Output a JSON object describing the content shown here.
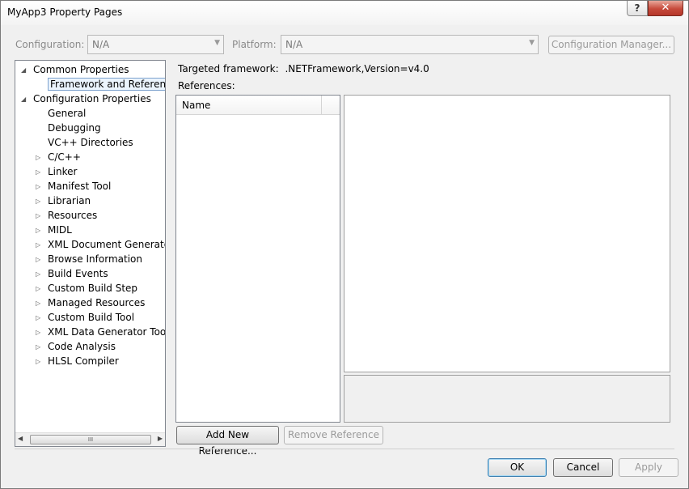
{
  "window": {
    "title": "MyApp3 Property Pages",
    "help_glyph": "?",
    "close_glyph": "✕"
  },
  "toolbar": {
    "configuration_label": "Configuration:",
    "configuration_value": "N/A",
    "platform_label": "Platform:",
    "platform_value": "N/A",
    "config_manager_label": "Configuration Manager..."
  },
  "tree": {
    "items": [
      {
        "label": "Common Properties",
        "expander": "◢"
      },
      {
        "label": "Framework and References",
        "expander": ""
      },
      {
        "label": "Configuration Properties",
        "expander": "◢"
      },
      {
        "label": "General",
        "expander": ""
      },
      {
        "label": "Debugging",
        "expander": ""
      },
      {
        "label": "VC++ Directories",
        "expander": ""
      },
      {
        "label": "C/C++",
        "expander": "▷"
      },
      {
        "label": "Linker",
        "expander": "▷"
      },
      {
        "label": "Manifest Tool",
        "expander": "▷"
      },
      {
        "label": "Librarian",
        "expander": "▷"
      },
      {
        "label": "Resources",
        "expander": "▷"
      },
      {
        "label": "MIDL",
        "expander": "▷"
      },
      {
        "label": "XML Document Generator",
        "expander": "▷"
      },
      {
        "label": "Browse Information",
        "expander": "▷"
      },
      {
        "label": "Build Events",
        "expander": "▷"
      },
      {
        "label": "Custom Build Step",
        "expander": "▷"
      },
      {
        "label": "Managed Resources",
        "expander": "▷"
      },
      {
        "label": "Custom Build Tool",
        "expander": "▷"
      },
      {
        "label": "XML Data Generator Tool",
        "expander": "▷"
      },
      {
        "label": "Code Analysis",
        "expander": "▷"
      },
      {
        "label": "HLSL Compiler",
        "expander": "▷"
      }
    ],
    "selected_index": 1,
    "scroll_thumb_glyph": "III"
  },
  "main": {
    "targeted_framework_label": "Targeted framework:",
    "targeted_framework_value": ".NETFramework,Version=v4.0",
    "references_label": "References:",
    "list_header_name": "Name",
    "add_reference_label": "Add New Reference...",
    "remove_reference_label": "Remove Reference"
  },
  "footer": {
    "ok_label": "OK",
    "cancel_label": "Cancel",
    "apply_label": "Apply"
  }
}
